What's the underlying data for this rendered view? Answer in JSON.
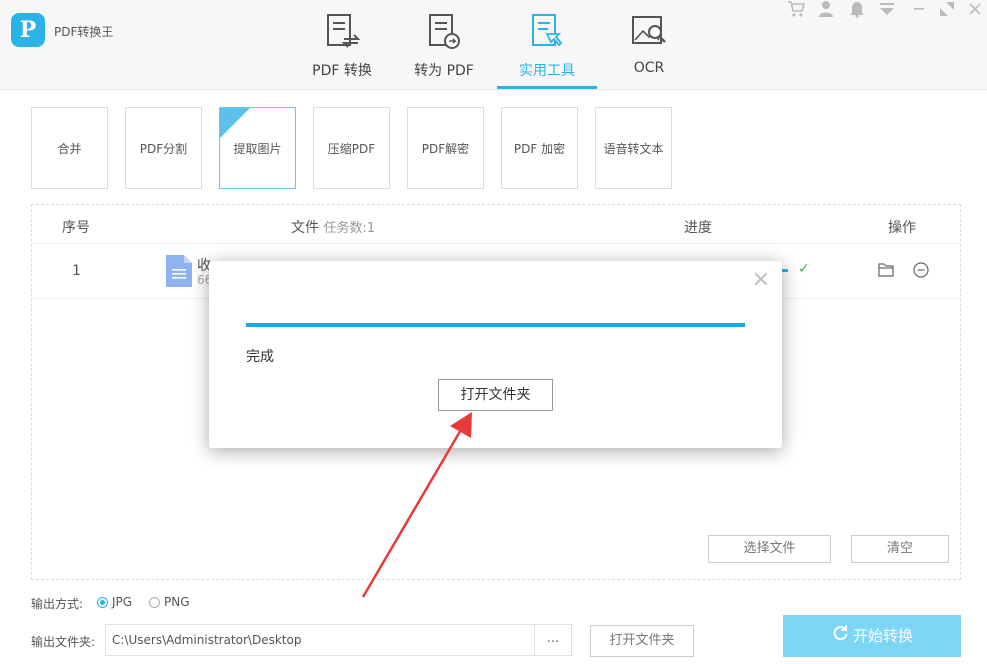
{
  "app": {
    "title": "PDF转换王",
    "logo_letter": "P"
  },
  "nav": [
    {
      "label": "PDF 转换",
      "icon": "pdf-convert-icon"
    },
    {
      "label": "转为 PDF",
      "icon": "to-pdf-icon"
    },
    {
      "label": "实用工具",
      "icon": "tools-icon",
      "active": true
    },
    {
      "label": "OCR",
      "icon": "ocr-icon"
    }
  ],
  "window_icons": [
    "cart-icon",
    "user-icon",
    "bell-icon",
    "dropdown-icon",
    "minimize-icon",
    "restore-icon",
    "close-icon"
  ],
  "tools": [
    {
      "label": "合并"
    },
    {
      "label": "PDF分割"
    },
    {
      "label": "提取图片",
      "selected": true
    },
    {
      "label": "压缩PDF"
    },
    {
      "label": "PDF解密"
    },
    {
      "label": "PDF 加密"
    },
    {
      "label": "语音转文本"
    }
  ],
  "table": {
    "headers": {
      "index": "序号",
      "file": "文件",
      "task_count": "任务数:1",
      "progress": "进度",
      "actions": "操作"
    },
    "rows": [
      {
        "index": "1",
        "name_partial": "收",
        "size_partial": "66",
        "progress_status": "✓"
      }
    ]
  },
  "buttons": {
    "select_file": "选择文件",
    "clear": "清空",
    "start_convert": "开始转换",
    "open_folder": "打开文件夹",
    "browse": "..."
  },
  "output": {
    "format_label": "输出方式:",
    "format_options": [
      "JPG",
      "PNG"
    ],
    "format_selected": "JPG",
    "folder_label": "输出文件夹:",
    "folder_path": "C:\\Users\\Administrator\\Desktop"
  },
  "dialog": {
    "status": "完成",
    "progress": 1.0,
    "open_folder_label": "打开文件夹",
    "close": "×"
  },
  "colors": {
    "accent": "#2bb3e8",
    "progress": "#1aa9e4",
    "arrow": "#e83a3a",
    "start_button": "#7dd6f6"
  }
}
